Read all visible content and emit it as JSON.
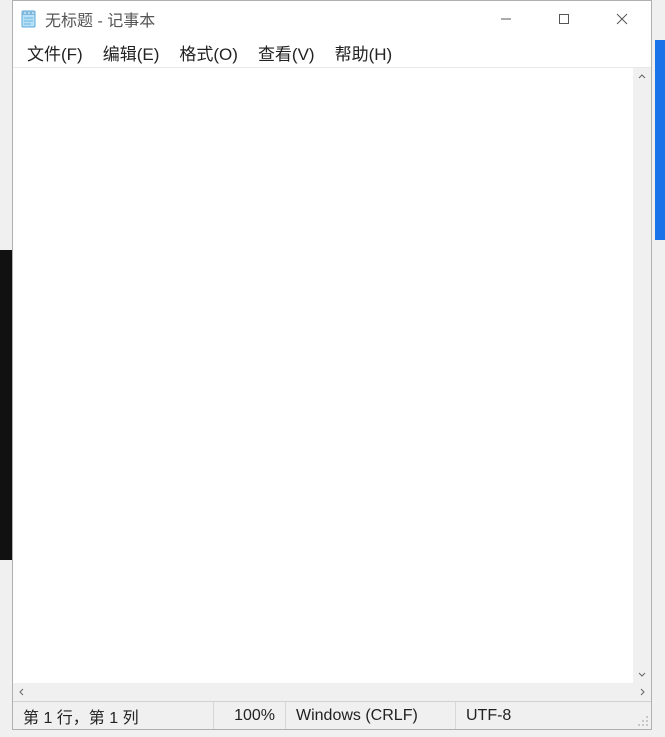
{
  "title": {
    "document": "无标题",
    "separator": " - ",
    "app": "记事本"
  },
  "menu": {
    "file": "文件(F)",
    "edit": "编辑(E)",
    "format": "格式(O)",
    "view": "查看(V)",
    "help": "帮助(H)"
  },
  "editor": {
    "content": ""
  },
  "status": {
    "position": "第 1 行，第 1 列",
    "zoom": "100%",
    "eol": "Windows (CRLF)",
    "encoding": "UTF-8"
  }
}
